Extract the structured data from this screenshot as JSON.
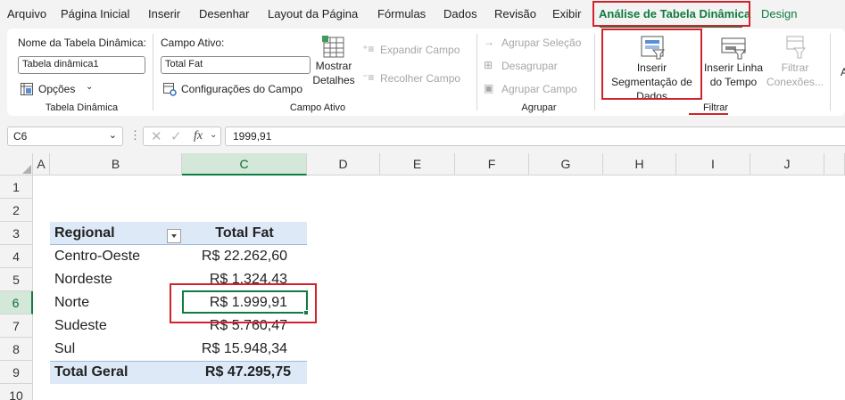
{
  "menu": {
    "tabs": [
      "Arquivo",
      "Página Inicial",
      "Inserir",
      "Desenhar",
      "Layout da Página",
      "Fórmulas",
      "Dados",
      "Revisão",
      "Exibir",
      "Análise de Tabela Dinâmica",
      "Design"
    ]
  },
  "ribbon": {
    "pivot_table": {
      "name_label": "Nome da Tabela Dinâmica:",
      "name_value": "Tabela dinâmica1",
      "options_label": "Opções",
      "caption": "Tabela Dinâmica"
    },
    "active_field": {
      "label": "Campo Ativo:",
      "value": "Total Fat",
      "field_settings_label": "Configurações do Campo",
      "show_details_label": "Mostrar Detalhes",
      "expand_label": "Expandir Campo",
      "collapse_label": "Recolher Campo",
      "caption": "Campo Ativo"
    },
    "group": {
      "group_selection_label": "Agrupar Seleção",
      "ungroup_label": "Desagrupar",
      "group_field_label": "Agrupar Campo",
      "caption": "Agrupar"
    },
    "filter": {
      "insert_slicer_label": "Inserir Segmentação de Dados",
      "insert_timeline_label": "Inserir Linha do Tempo",
      "filter_connections_label": "Filtrar Conexões...",
      "caption": "Filtrar"
    },
    "next_group_glyph": "A"
  },
  "formula_bar": {
    "name_box": "C6",
    "fx_label": "fx",
    "formula": "1999,91"
  },
  "sheet": {
    "columns": [
      "A",
      "B",
      "C",
      "D",
      "E",
      "F",
      "G",
      "H",
      "I",
      "J"
    ],
    "rows": [
      "1",
      "2",
      "3",
      "4",
      "5",
      "6",
      "7",
      "8",
      "9",
      "10"
    ],
    "active_cell": "C6",
    "pivot": {
      "header_row": "Regional",
      "header_value": "Total Fat",
      "rows": [
        {
          "label": "Centro-Oeste",
          "value": "R$ 22.262,60"
        },
        {
          "label": "Nordeste",
          "value": "R$ 1.324,43"
        },
        {
          "label": "Norte",
          "value": "R$ 1.999,91"
        },
        {
          "label": "Sudeste",
          "value": "R$ 5.760,47"
        },
        {
          "label": "Sul",
          "value": "R$ 15.948,34"
        }
      ],
      "total_label": "Total Geral",
      "total_value": "R$ 47.295,75"
    }
  },
  "colors": {
    "accent_green": "#107c41",
    "highlight_red": "#d0232b",
    "pivot_header_blue": "#dde9f7"
  }
}
